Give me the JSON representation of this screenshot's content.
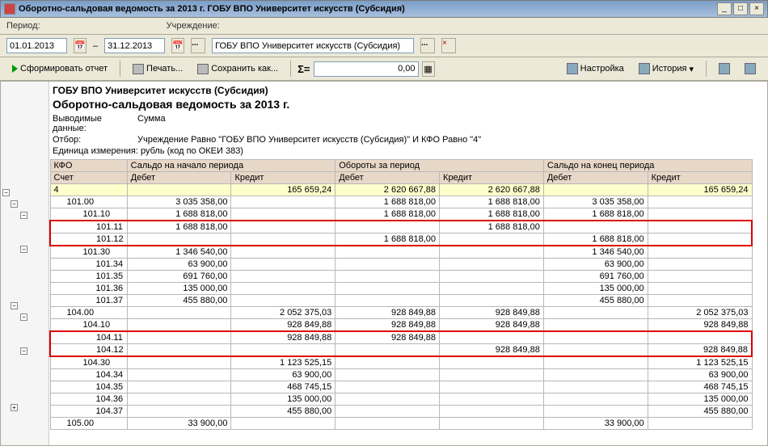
{
  "window": {
    "title": "Оборотно-сальдовая ведомость за 2013 г. ГОБУ ВПО Университет искусств (Субсидия)"
  },
  "params": {
    "period_label": "Период:",
    "date_from": "01.01.2013",
    "date_to": "31.12.2013",
    "institution_label": "Учреждение:",
    "institution": "ГОБУ ВПО Университет искусств (Субсидия)"
  },
  "toolbar": {
    "form_report": "Сформировать отчет",
    "print": "Печать...",
    "save_as": "Сохранить как...",
    "sigma": "Σ=",
    "sum_value": "0,00",
    "settings": "Настройка",
    "history": "История"
  },
  "report": {
    "org": "ГОБУ ВПО Университет искусств (Субсидия)",
    "title": "Оборотно-сальдовая ведомость за 2013 г.",
    "output_lbl": "Выводимые данные:",
    "output_val": "Сумма",
    "filter_lbl": "Отбор:",
    "filter_val": "Учреждение Равно \"ГОБУ ВПО Университет искусств (Субсидия)\" И КФО Равно \"4\"",
    "unit": "Единица измерения: рубль (код по ОКЕИ 383)"
  },
  "headers": {
    "kfo": "КФО",
    "acc": "Счет",
    "sbeg": "Сальдо на начало периода",
    "turn": "Обороты за период",
    "send": "Сальдо на конец периода",
    "debit": "Дебет",
    "credit": "Кредит"
  },
  "rows": [
    {
      "acc": "4",
      "sb_d": "",
      "sb_c": "165 659,24",
      "t_d": "2 620 667,88",
      "t_c": "2 620 667,88",
      "se_d": "",
      "se_c": "165 659,24",
      "cls": "r-total",
      "lvl": 0
    },
    {
      "acc": "101.00",
      "sb_d": "3 035 358,00",
      "sb_c": "",
      "t_d": "1 688 818,00",
      "t_c": "1 688 818,00",
      "se_d": "3 035 358,00",
      "se_c": "",
      "lvl": 1
    },
    {
      "acc": "101.10",
      "sb_d": "1 688 818,00",
      "sb_c": "",
      "t_d": "1 688 818,00",
      "t_c": "1 688 818,00",
      "se_d": "1 688 818,00",
      "se_c": "",
      "lvl": 2
    },
    {
      "acc": "101.11",
      "sb_d": "1 688 818,00",
      "sb_c": "",
      "t_d": "",
      "t_c": "1 688 818,00",
      "se_d": "",
      "se_c": "",
      "lvl": 3,
      "hl": "top"
    },
    {
      "acc": "101.12",
      "sb_d": "",
      "sb_c": "",
      "t_d": "1 688 818,00",
      "t_c": "",
      "se_d": "1 688 818,00",
      "se_c": "",
      "lvl": 3,
      "hl": "bot"
    },
    {
      "acc": "101.30",
      "sb_d": "1 346 540,00",
      "sb_c": "",
      "t_d": "",
      "t_c": "",
      "se_d": "1 346 540,00",
      "se_c": "",
      "lvl": 2
    },
    {
      "acc": "101.34",
      "sb_d": "63 900,00",
      "sb_c": "",
      "t_d": "",
      "t_c": "",
      "se_d": "63 900,00",
      "se_c": "",
      "lvl": 3
    },
    {
      "acc": "101.35",
      "sb_d": "691 760,00",
      "sb_c": "",
      "t_d": "",
      "t_c": "",
      "se_d": "691 760,00",
      "se_c": "",
      "lvl": 3
    },
    {
      "acc": "101.36",
      "sb_d": "135 000,00",
      "sb_c": "",
      "t_d": "",
      "t_c": "",
      "se_d": "135 000,00",
      "se_c": "",
      "lvl": 3
    },
    {
      "acc": "101.37",
      "sb_d": "455 880,00",
      "sb_c": "",
      "t_d": "",
      "t_c": "",
      "se_d": "455 880,00",
      "se_c": "",
      "lvl": 3
    },
    {
      "acc": "104.00",
      "sb_d": "",
      "sb_c": "2 052 375,03",
      "t_d": "928 849,88",
      "t_c": "928 849,88",
      "se_d": "",
      "se_c": "2 052 375,03",
      "lvl": 1
    },
    {
      "acc": "104.10",
      "sb_d": "",
      "sb_c": "928 849,88",
      "t_d": "928 849,88",
      "t_c": "928 849,88",
      "se_d": "",
      "se_c": "928 849,88",
      "lvl": 2
    },
    {
      "acc": "104.11",
      "sb_d": "",
      "sb_c": "928 849,88",
      "t_d": "928 849,88",
      "t_c": "",
      "se_d": "",
      "se_c": "",
      "lvl": 3,
      "hl": "top"
    },
    {
      "acc": "104.12",
      "sb_d": "",
      "sb_c": "",
      "t_d": "",
      "t_c": "928 849,88",
      "se_d": "",
      "se_c": "928 849,88",
      "lvl": 3,
      "hl": "bot"
    },
    {
      "acc": "104.30",
      "sb_d": "",
      "sb_c": "1 123 525,15",
      "t_d": "",
      "t_c": "",
      "se_d": "",
      "se_c": "1 123 525,15",
      "lvl": 2
    },
    {
      "acc": "104.34",
      "sb_d": "",
      "sb_c": "63 900,00",
      "t_d": "",
      "t_c": "",
      "se_d": "",
      "se_c": "63 900,00",
      "lvl": 3
    },
    {
      "acc": "104.35",
      "sb_d": "",
      "sb_c": "468 745,15",
      "t_d": "",
      "t_c": "",
      "se_d": "",
      "se_c": "468 745,15",
      "lvl": 3
    },
    {
      "acc": "104.36",
      "sb_d": "",
      "sb_c": "135 000,00",
      "t_d": "",
      "t_c": "",
      "se_d": "",
      "se_c": "135 000,00",
      "lvl": 3
    },
    {
      "acc": "104.37",
      "sb_d": "",
      "sb_c": "455 880,00",
      "t_d": "",
      "t_c": "",
      "se_d": "",
      "se_c": "455 880,00",
      "lvl": 3
    },
    {
      "acc": "105.00",
      "sb_d": "33 900,00",
      "sb_c": "",
      "t_d": "",
      "t_c": "",
      "se_d": "33 900,00",
      "se_c": "",
      "lvl": 1
    }
  ]
}
